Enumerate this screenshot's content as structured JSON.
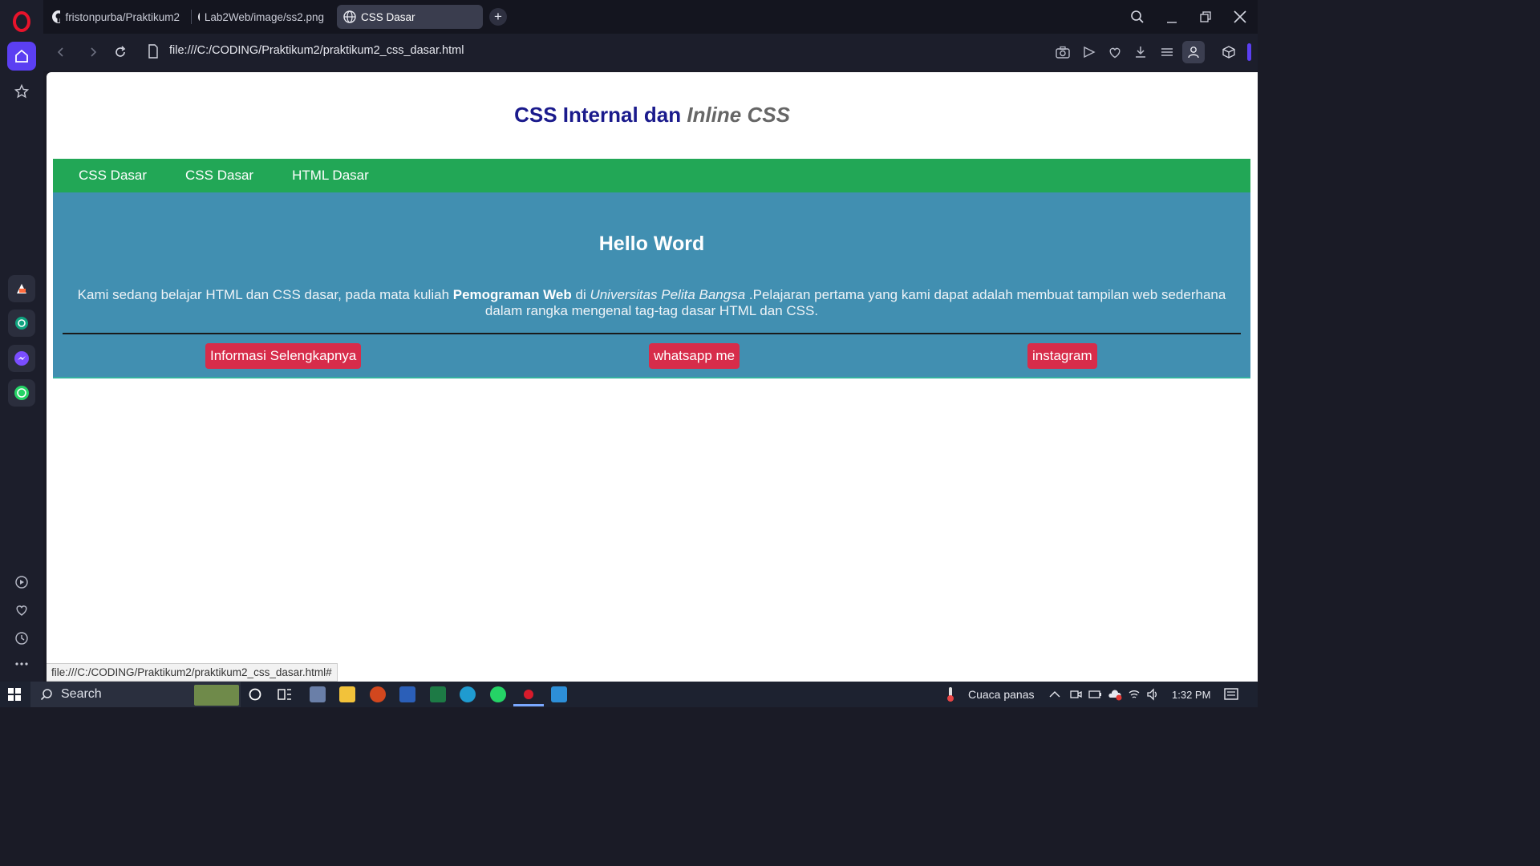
{
  "browser": {
    "tabs": [
      {
        "label": "fristonpurba/Praktikum2",
        "icon": "github-icon"
      },
      {
        "label": "Lab2Web/image/ss2.png",
        "icon": "github-icon"
      },
      {
        "label": "CSS Dasar",
        "icon": "globe-icon"
      }
    ],
    "new_tab": "+",
    "url": "file:///C:/CODING/Praktikum2/praktikum2_css_dasar.html",
    "status_url": "file:///C:/CODING/Praktikum2/praktikum2_css_dasar.html#",
    "accent_color": "#5b3ff2"
  },
  "page": {
    "title_plain": "CSS Internal dan ",
    "title_em": "Inline CSS",
    "nav": [
      "CSS Dasar",
      "CSS Dasar",
      "HTML Dasar"
    ],
    "heading": "Hello Word",
    "para_1": "Kami sedang belajar HTML dan CSS dasar, pada mata kuliah ",
    "para_bold": "Pemograman Web",
    "para_2": " di ",
    "para_em": "Universitas Pelita Bangsa",
    "para_3": " .Pelajaran pertama yang kami dapat adalah membuat tampilan web sederhana dalam rangka mengenal tag-tag dasar HTML dan CSS.",
    "buttons": [
      "Informasi Selengkapnya",
      "whatsapp me",
      "instagram"
    ],
    "colors": {
      "nav_bg": "#22a756",
      "content_bg": "#418fb1",
      "button_bg": "#d72c4a",
      "title": "#1a1a8c"
    }
  },
  "taskbar": {
    "search_placeholder": "Search",
    "weather": "Cuaca panas",
    "time": "1:32 PM"
  }
}
